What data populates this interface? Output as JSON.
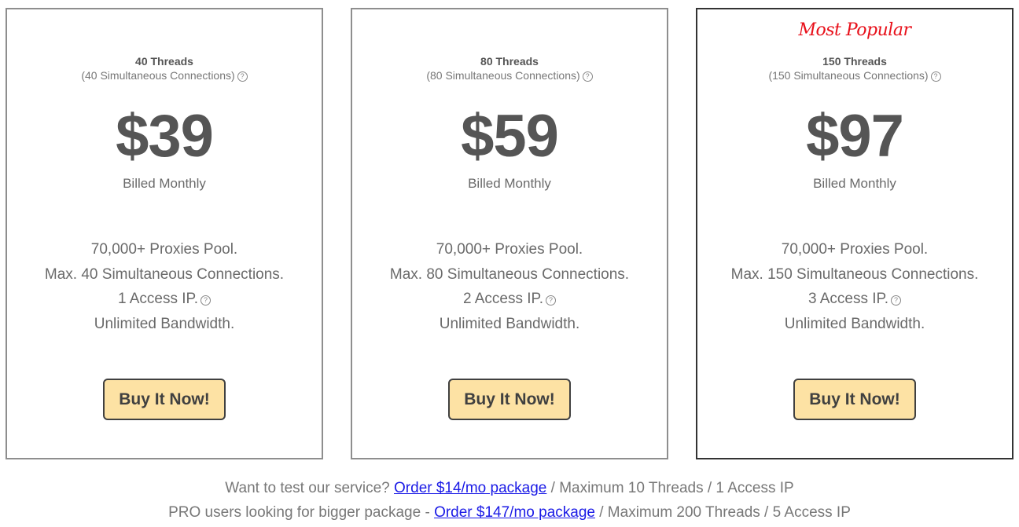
{
  "plans": [
    {
      "badge": "",
      "threads": "40 Threads",
      "connections": "(40 Simultaneous Connections)",
      "price": "$39",
      "billing": "Billed Monthly",
      "features": [
        "70,000+ Proxies Pool.",
        "Max. 40 Simultaneous Connections.",
        "1 Access IP.",
        "Unlimited Bandwidth."
      ],
      "button": "Buy It Now!"
    },
    {
      "badge": "",
      "threads": "80 Threads",
      "connections": "(80 Simultaneous Connections)",
      "price": "$59",
      "billing": "Billed Monthly",
      "features": [
        "70,000+ Proxies Pool.",
        "Max. 80 Simultaneous Connections.",
        "2 Access IP.",
        "Unlimited Bandwidth."
      ],
      "button": "Buy It Now!"
    },
    {
      "badge": "Most Popular",
      "threads": "150 Threads",
      "connections": "(150 Simultaneous Connections)",
      "price": "$97",
      "billing": "Billed Monthly",
      "features": [
        "70,000+ Proxies Pool.",
        "Max. 150 Simultaneous Connections.",
        "3 Access IP.",
        "Unlimited Bandwidth."
      ],
      "button": "Buy It Now!"
    }
  ],
  "help_icon_glyph": "?",
  "footer": [
    {
      "prefix": "Want to test our service? ",
      "link": "Order $14/mo package",
      "suffix": " / Maximum 10 Threads / 1 Access IP"
    },
    {
      "prefix": "PRO users looking for bigger package - ",
      "link": "Order $147/mo package",
      "suffix": " / Maximum 200 Threads / 5 Access IP"
    }
  ],
  "colors": {
    "button_bg": "#fde2a4",
    "link": "#1a1ae6",
    "badge": "#e8101a",
    "popular_border": "#333333"
  }
}
